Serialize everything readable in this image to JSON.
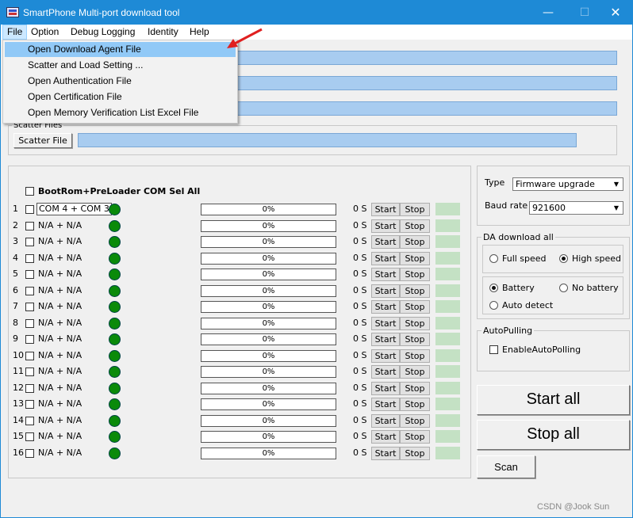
{
  "window": {
    "title": "SmartPhone Multi-port download tool"
  },
  "menubar": [
    "File",
    "Option",
    "Debug Logging",
    "Identity",
    "Help"
  ],
  "file_menu": [
    "Open Download Agent File",
    "Scatter and Load Setting ...",
    "Open Authentication File",
    "Open Certification File",
    "Open Memory Verification List Excel File"
  ],
  "scatter": {
    "group_label": "Scatter Files",
    "button": "Scatter File"
  },
  "ports": {
    "select_all_label": "BootRom+PreLoader COM Sel All",
    "start_label": "Start",
    "stop_label": "Stop",
    "rows": [
      {
        "num": "1",
        "name": "COM 4 + COM 3",
        "progress": "0%",
        "time": "0 S"
      },
      {
        "num": "2",
        "name": "N/A + N/A",
        "progress": "0%",
        "time": "0 S"
      },
      {
        "num": "3",
        "name": "N/A + N/A",
        "progress": "0%",
        "time": "0 S"
      },
      {
        "num": "4",
        "name": "N/A + N/A",
        "progress": "0%",
        "time": "0 S"
      },
      {
        "num": "5",
        "name": "N/A + N/A",
        "progress": "0%",
        "time": "0 S"
      },
      {
        "num": "6",
        "name": "N/A + N/A",
        "progress": "0%",
        "time": "0 S"
      },
      {
        "num": "7",
        "name": "N/A + N/A",
        "progress": "0%",
        "time": "0 S"
      },
      {
        "num": "8",
        "name": "N/A + N/A",
        "progress": "0%",
        "time": "0 S"
      },
      {
        "num": "9",
        "name": "N/A + N/A",
        "progress": "0%",
        "time": "0 S"
      },
      {
        "num": "10",
        "name": "N/A + N/A",
        "progress": "0%",
        "time": "0 S"
      },
      {
        "num": "11",
        "name": "N/A + N/A",
        "progress": "0%",
        "time": "0 S"
      },
      {
        "num": "12",
        "name": "N/A + N/A",
        "progress": "0%",
        "time": "0 S"
      },
      {
        "num": "13",
        "name": "N/A + N/A",
        "progress": "0%",
        "time": "0 S"
      },
      {
        "num": "14",
        "name": "N/A + N/A",
        "progress": "0%",
        "time": "0 S"
      },
      {
        "num": "15",
        "name": "N/A + N/A",
        "progress": "0%",
        "time": "0 S"
      },
      {
        "num": "16",
        "name": "N/A + N/A",
        "progress": "0%",
        "time": "0 S"
      }
    ]
  },
  "settings": {
    "type_label": "Type",
    "type_value": "Firmware upgrade",
    "baud_label": "Baud rate",
    "baud_value": "921600",
    "da_group": "DA download all",
    "full_speed": "Full speed",
    "high_speed": "High speed",
    "battery": "Battery",
    "no_battery": "No battery",
    "auto_detect": "Auto detect",
    "autopolling_group": "AutoPulling",
    "enable_autopolling": "EnableAutoPolling"
  },
  "actions": {
    "start_all": "Start all",
    "stop_all": "Stop all",
    "scan": "Scan"
  },
  "watermark": "CSDN @Jook Sun",
  "colors": {
    "titlebar": "#1e8ad6",
    "menu_highlight": "#91c9f7",
    "led": "#0a8a0a",
    "status_box": "#c4e1c4",
    "arrow": "#e02020"
  }
}
